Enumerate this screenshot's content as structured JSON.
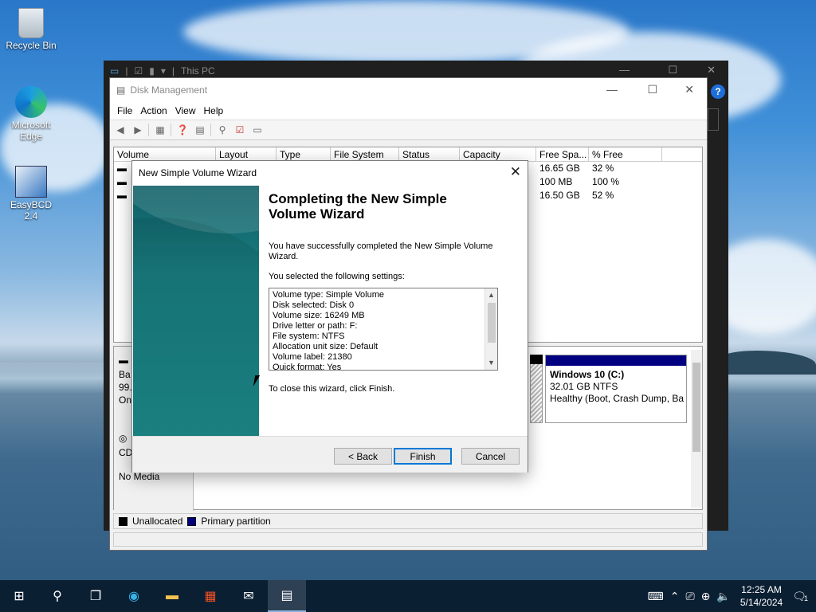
{
  "desktop": {
    "icons": [
      {
        "label": "Recycle Bin",
        "icon": "recycle-bin-icon"
      },
      {
        "label": "Microsoft Edge",
        "icon": "edge-icon"
      },
      {
        "label": "EasyBCD 2.4",
        "icon": "easybcd-icon"
      }
    ]
  },
  "explorer": {
    "title": "This PC"
  },
  "disk_management": {
    "title": "Disk Management",
    "menu": [
      "File",
      "Action",
      "View",
      "Help"
    ],
    "volume_columns": [
      "Volume",
      "Layout",
      "Type",
      "File System",
      "Status",
      "Capacity",
      "Free Spa...",
      "% Free"
    ],
    "volume_rows": [
      {
        "free": "16.65 GB",
        "pct": "32 %"
      },
      {
        "free": "100 MB",
        "pct": "100 %"
      },
      {
        "free": "16.50 GB",
        "pct": "52 %"
      }
    ],
    "disk_left": {
      "line1": "Ba",
      "line2": "99.",
      "line3": "On",
      "cd_label": "CD",
      "cd_status": "No Media"
    },
    "partition_c": {
      "name": "Windows 10  (C:)",
      "size": "32.01 GB NTFS",
      "status": "Healthy (Boot, Crash Dump, Ba"
    },
    "legend": [
      {
        "label": "Unallocated",
        "color": "#000000"
      },
      {
        "label": "Primary partition",
        "color": "#000080"
      }
    ]
  },
  "wizard": {
    "title": "New Simple Volume Wizard",
    "heading_line1": "Completing the New Simple",
    "heading_line2": "Volume Wizard",
    "success_line1": "You have successfully completed the New Simple Volume",
    "success_line2": "Wizard.",
    "settings_intro": "You selected the following settings:",
    "settings": [
      "Volume type: Simple Volume",
      "Disk selected: Disk 0",
      "Volume size: 16249 MB",
      "Drive letter or path: F:",
      "File system: NTFS",
      "Allocation unit size: Default",
      "Volume label: 21380",
      "Quick format: Yes"
    ],
    "close_hint": "To close this wizard, click Finish.",
    "back_label": "< Back",
    "finish_label": "Finish",
    "cancel_label": "Cancel"
  },
  "taskbar": {
    "time": "12:25 AM",
    "date": "5/14/2024",
    "notification_count": "1"
  }
}
